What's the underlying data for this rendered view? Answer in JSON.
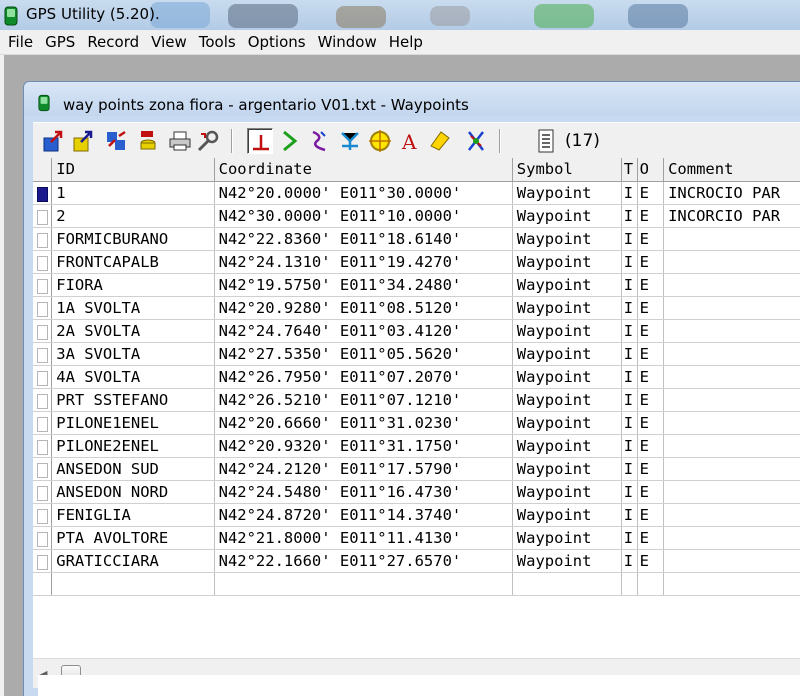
{
  "app": {
    "title": "GPS Utility (5.20)."
  },
  "menu": [
    "File",
    "GPS",
    "Record",
    "View",
    "Tools",
    "Options",
    "Window",
    "Help"
  ],
  "window": {
    "title": "way points zona fiora - argentario V01.txt - Waypoints"
  },
  "toolbar": {
    "count": "(17)"
  },
  "table": {
    "columns": [
      "ID",
      "Coordinate",
      "Symbol",
      "T",
      "O",
      "Comment"
    ],
    "rows": [
      [
        "1",
        "N42°20.0000' E011°30.0000'",
        "Waypoint",
        "I",
        "E",
        "INCROCIO PAR"
      ],
      [
        "2",
        "N42°30.0000' E011°10.0000'",
        "Waypoint",
        "I",
        "E",
        "INCORCIO PAR"
      ],
      [
        "FORMICBURANO",
        "N42°22.8360' E011°18.6140'",
        "Waypoint",
        "I",
        "E",
        ""
      ],
      [
        "FRONTCAPALB",
        "N42°24.1310' E011°19.4270'",
        "Waypoint",
        "I",
        "E",
        ""
      ],
      [
        "FIORA",
        "N42°19.5750' E011°34.2480'",
        "Waypoint",
        "I",
        "E",
        ""
      ],
      [
        "1A SVOLTA",
        "N42°20.9280' E011°08.5120'",
        "Waypoint",
        "I",
        "E",
        ""
      ],
      [
        "2A SVOLTA",
        "N42°24.7640' E011°03.4120'",
        "Waypoint",
        "I",
        "E",
        ""
      ],
      [
        "3A SVOLTA",
        "N42°27.5350' E011°05.5620'",
        "Waypoint",
        "I",
        "E",
        ""
      ],
      [
        "4A SVOLTA",
        "N42°26.7950' E011°07.2070'",
        "Waypoint",
        "I",
        "E",
        ""
      ],
      [
        "PRT SSTEFANO",
        "N42°26.5210' E011°07.1210'",
        "Waypoint",
        "I",
        "E",
        ""
      ],
      [
        "PILONE1ENEL",
        "N42°20.6660' E011°31.0230'",
        "Waypoint",
        "I",
        "E",
        ""
      ],
      [
        "PILONE2ENEL",
        "N42°20.9320' E011°31.1750'",
        "Waypoint",
        "I",
        "E",
        ""
      ],
      [
        "ANSEDON SUD",
        "N42°24.2120' E011°17.5790'",
        "Waypoint",
        "I",
        "E",
        ""
      ],
      [
        "ANSEDON NORD",
        "N42°24.5480' E011°16.4730'",
        "Waypoint",
        "I",
        "E",
        ""
      ],
      [
        "FENIGLIA",
        "N42°24.8720' E011°14.3740'",
        "Waypoint",
        "I",
        "E",
        ""
      ],
      [
        "PTA AVOLTORE",
        "N42°21.8000' E011°11.4130'",
        "Waypoint",
        "I",
        "E",
        ""
      ],
      [
        "GRATICCIARA",
        "N42°22.1660' E011°27.6570'",
        "Waypoint",
        "I",
        "E",
        ""
      ]
    ]
  }
}
